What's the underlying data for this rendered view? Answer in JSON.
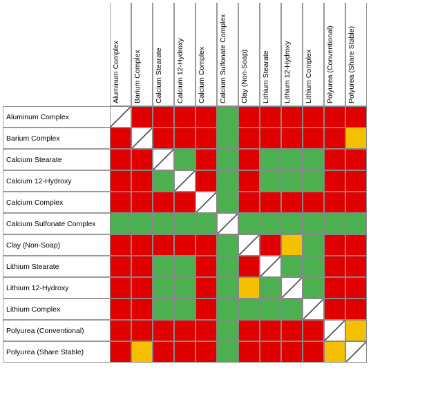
{
  "colHeaders": [
    "Aluminum Complex",
    "Barium Complex",
    "Calcium Stearate",
    "Calcium 12-Hydroxy",
    "Calcium Complex",
    "Calcium Sulfonate Complex",
    "Clay (Non-Soap)",
    "Lithium Stearate",
    "Lithium 12-Hydroxy",
    "Lithium Complex",
    "Polyurea (Conventional)",
    "Polyurea (Share Stable)"
  ],
  "rowHeaders": [
    "Aluminum Complex",
    "Barium Complex",
    "Calcium Stearate",
    "Calcium 12-Hydroxy",
    "Calcium Complex",
    "Calcium Sulfonate Complex",
    "Clay (Non-Soap)",
    "Lithium Stearate",
    "Lithium 12-Hydroxy",
    "Lithium Complex",
    "Polyurea (Conventional)",
    "Polyurea (Share Stable)"
  ],
  "grid": [
    [
      "D",
      "R",
      "R",
      "R",
      "R",
      "G",
      "R",
      "R",
      "R",
      "R",
      "R",
      "R"
    ],
    [
      "R",
      "D",
      "R",
      "R",
      "R",
      "G",
      "R",
      "R",
      "R",
      "R",
      "R",
      "Y"
    ],
    [
      "R",
      "R",
      "D",
      "G",
      "R",
      "G",
      "R",
      "G",
      "G",
      "G",
      "R",
      "R"
    ],
    [
      "R",
      "R",
      "G",
      "D",
      "R",
      "G",
      "R",
      "G",
      "G",
      "G",
      "R",
      "R"
    ],
    [
      "R",
      "R",
      "R",
      "R",
      "D",
      "G",
      "R",
      "R",
      "R",
      "R",
      "R",
      "R"
    ],
    [
      "G",
      "G",
      "G",
      "G",
      "G",
      "D",
      "G",
      "G",
      "G",
      "G",
      "G",
      "G"
    ],
    [
      "R",
      "R",
      "R",
      "R",
      "R",
      "G",
      "D",
      "R",
      "Y",
      "G",
      "R",
      "R"
    ],
    [
      "R",
      "R",
      "G",
      "G",
      "R",
      "G",
      "R",
      "D",
      "G",
      "G",
      "R",
      "R"
    ],
    [
      "R",
      "R",
      "G",
      "G",
      "R",
      "G",
      "Y",
      "G",
      "D",
      "G",
      "R",
      "R"
    ],
    [
      "R",
      "R",
      "G",
      "G",
      "R",
      "G",
      "G",
      "G",
      "G",
      "D",
      "R",
      "R"
    ],
    [
      "R",
      "R",
      "R",
      "R",
      "R",
      "G",
      "R",
      "R",
      "R",
      "R",
      "D",
      "Y"
    ],
    [
      "R",
      "Y",
      "R",
      "R",
      "R",
      "G",
      "R",
      "R",
      "R",
      "R",
      "Y",
      "D"
    ]
  ],
  "cellSize": 31,
  "colHeaderHeight": 150,
  "rowHeaderWidth": 155
}
